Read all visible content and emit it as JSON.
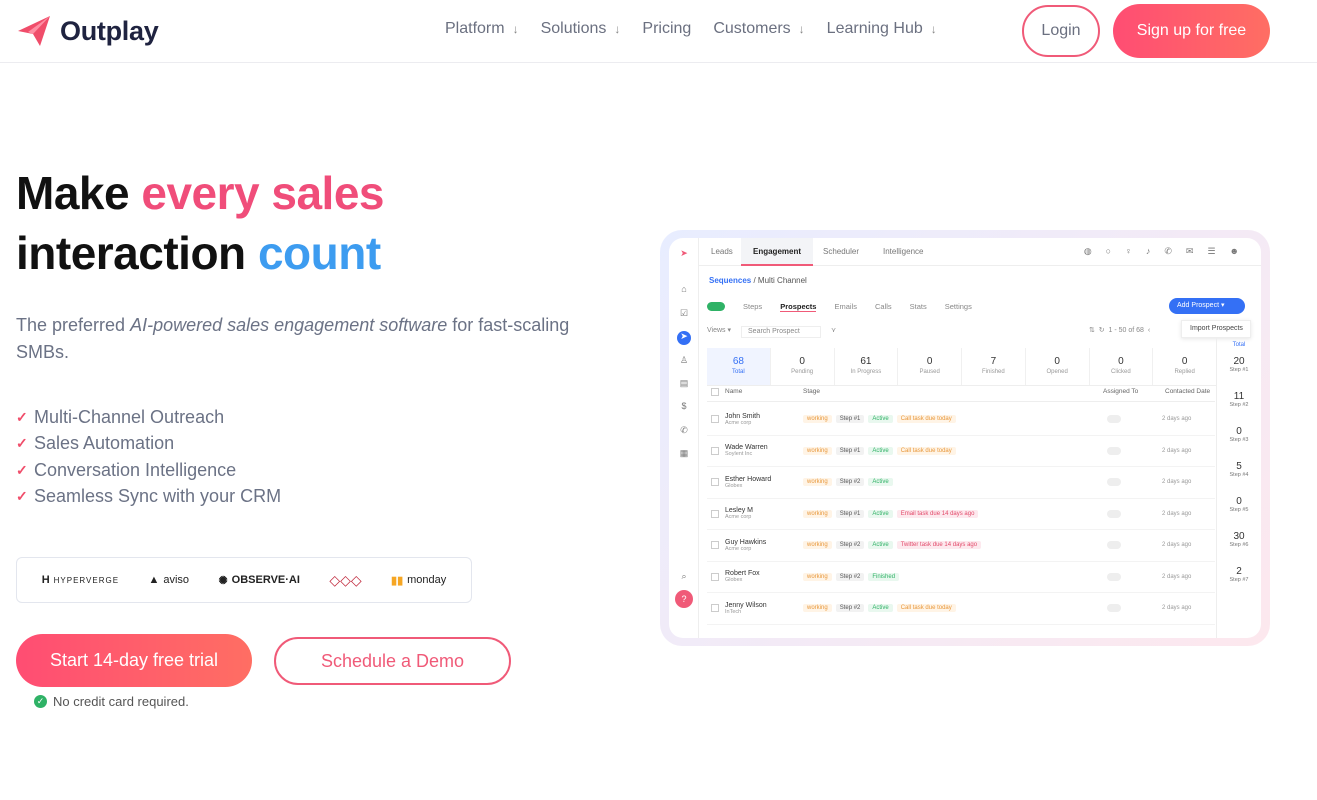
{
  "nav": {
    "brand": "Outplay",
    "links": [
      {
        "label": "Platform",
        "chevron": "↓"
      },
      {
        "label": "Solutions",
        "chevron": "↓"
      },
      {
        "label": "Pricing",
        "chevron": ""
      },
      {
        "label": "Customers",
        "chevron": "↓"
      },
      {
        "label": "Learning Hub",
        "chevron": "↓"
      }
    ],
    "login": "Login",
    "signup": "Sign up for free"
  },
  "hero": {
    "title_1": "Make ",
    "title_2": "every sales",
    "title_3": "interaction ",
    "title_4": "count",
    "sub_1": "The preferred ",
    "sub_2": "AI-powered sales engagement software",
    "sub_3": " for fast-scaling SMBs.",
    "features": [
      "Multi-Channel Outreach",
      "Sales Automation",
      "Conversation Intelligence",
      "Seamless Sync with your CRM"
    ],
    "logos": [
      "HYPERVERGE",
      "aviso",
      "OBSERVE·AI",
      "monday"
    ],
    "cta_trial": "Start 14-day free trial",
    "cta_demo": "Schedule a Demo",
    "no_cc": "No credit card required."
  },
  "app": {
    "tabs": [
      "Leads",
      "Engagement",
      "Scheduler",
      "Intelligence"
    ],
    "breadcrumb_root": "Sequences",
    "breadcrumb_leaf": "Multi Channel",
    "subtabs": [
      "Steps",
      "Prospects",
      "Emails",
      "Calls",
      "Stats",
      "Settings"
    ],
    "add_button": "Add Prospect",
    "import": "Import Prospects",
    "views": "Views",
    "search_placeholder": "Search Prospect",
    "pager": "1 - 50 of 68",
    "stats": [
      {
        "n": "68",
        "l": "Total"
      },
      {
        "n": "0",
        "l": "Pending"
      },
      {
        "n": "61",
        "l": "In Progress"
      },
      {
        "n": "0",
        "l": "Paused"
      },
      {
        "n": "7",
        "l": "Finished"
      },
      {
        "n": "0",
        "l": "Opened"
      },
      {
        "n": "0",
        "l": "Clicked"
      },
      {
        "n": "0",
        "l": "Replied"
      }
    ],
    "right_label": "Total",
    "steps": [
      {
        "n": "20",
        "l": "Step #1"
      },
      {
        "n": "11",
        "l": "Step #2"
      },
      {
        "n": "0",
        "l": "Step #3"
      },
      {
        "n": "5",
        "l": "Step #4"
      },
      {
        "n": "0",
        "l": "Step #5"
      },
      {
        "n": "30",
        "l": "Step #6"
      },
      {
        "n": "2",
        "l": "Step #7"
      }
    ],
    "headers": [
      "Name",
      "Stage",
      "Assigned To",
      "Contacted Date"
    ],
    "rows": [
      {
        "name": "John Smith",
        "company": "Acme corp",
        "stage": "working",
        "step": "Step #1",
        "status": "Active",
        "task": "Call task due today",
        "task_type": "c",
        "date": "2 days ago"
      },
      {
        "name": "Wade Warren",
        "company": "Soylent Inc",
        "stage": "working",
        "step": "Step #1",
        "status": "Active",
        "task": "Call task due today",
        "task_type": "c",
        "date": "2 days ago"
      },
      {
        "name": "Esther Howard",
        "company": "Globex",
        "stage": "working",
        "step": "Step #2",
        "status": "Active",
        "task": "",
        "task_type": "",
        "date": "2 days ago"
      },
      {
        "name": "Lesley M",
        "company": "Acme corp",
        "stage": "working",
        "step": "Step #1",
        "status": "Active",
        "task": "Email task due 14 days ago",
        "task_type": "e",
        "date": "2 days ago"
      },
      {
        "name": "Guy Hawkins",
        "company": "Acme corp",
        "stage": "working",
        "step": "Step #2",
        "status": "Active",
        "task": "Twitter task due 14 days ago",
        "task_type": "e",
        "date": "2 days ago"
      },
      {
        "name": "Robert Fox",
        "company": "Globex",
        "stage": "working",
        "step": "Step #2",
        "status": "Finished",
        "task": "",
        "task_type": "",
        "date": "2 days ago"
      },
      {
        "name": "Jenny Wilson",
        "company": "InTech",
        "stage": "working",
        "step": "Step #2",
        "status": "Active",
        "task": "Call task due today",
        "task_type": "c",
        "date": "2 days ago"
      }
    ]
  },
  "colors": {
    "pink": "#f04d7a",
    "blue": "#3d9cf0",
    "accent": "#3470f5"
  }
}
